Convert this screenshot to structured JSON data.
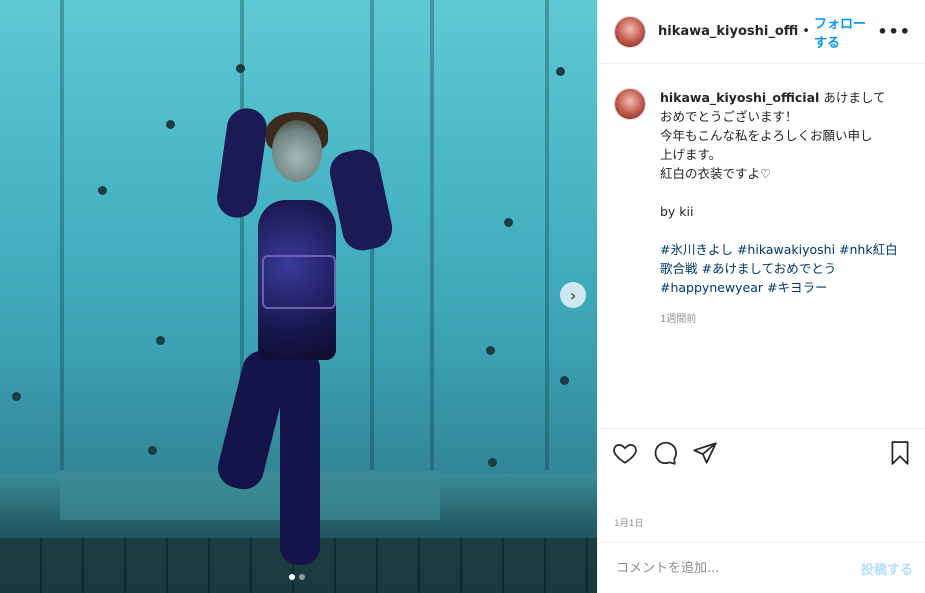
{
  "header": {
    "username": "hikawa_kiyoshi_offi",
    "separator": "•",
    "follow_label": "フォローする",
    "more_label": "•••"
  },
  "caption": {
    "username": "hikawa_kiyoshi_official",
    "lines": [
      "あけまして",
      "おめでとうございます！",
      "今年もこんな私をよろしくお願い申し",
      "上げます。",
      "紅白の衣装ですよ♡",
      "",
      "by kii",
      ""
    ],
    "hashtags_line1": "#氷川きよし #hikawakiyoshi #nhk紅白",
    "hashtags_line2": "歌合戦 #あけましておめでとう",
    "hashtags_line3": "#happynewyear #キヨラー",
    "time_ago": "1週間前"
  },
  "actions": {
    "like_icon": "heart-icon",
    "comment_icon": "speech-bubble-icon",
    "share_icon": "paper-plane-icon",
    "save_icon": "bookmark-icon"
  },
  "post_date": "1月1日",
  "comment_box": {
    "placeholder": "コメントを追加...",
    "post_label": "投稿する"
  },
  "carousel": {
    "next_symbol": "›",
    "total": 2,
    "current": 1
  },
  "colors": {
    "accent": "#0095f6",
    "post_disabled": "#b2dffc",
    "hashtag": "#00376b",
    "muted": "#8e8e8e"
  }
}
